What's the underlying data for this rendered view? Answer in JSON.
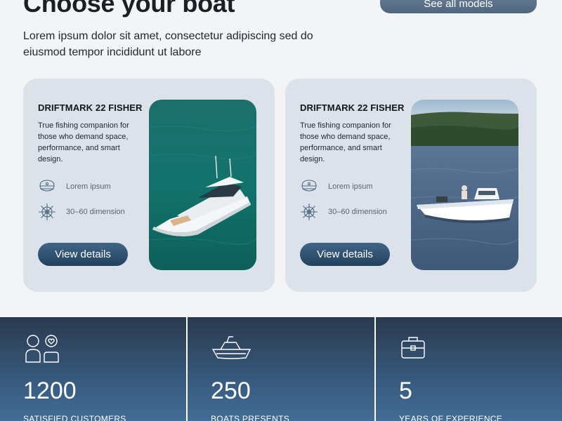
{
  "header": {
    "title": "Choose your boat",
    "see_all_label": "See all models",
    "intro": "Lorem ipsum dolor sit amet, consectetur adipiscing sed do eiusmod tempor incididunt ut labore"
  },
  "cards": [
    {
      "title": "DRIFTMARK 22 FISHER",
      "description": "True fishing companion for those who demand space, performance, and smart design.",
      "features": [
        {
          "icon": "captain-hat-icon",
          "label": "Lorem ipsum"
        },
        {
          "icon": "ship-wheel-icon",
          "label": "30–60 dimension"
        }
      ],
      "button_label": "View details",
      "image": "motor-yacht-on-sea"
    },
    {
      "title": "DRIFTMARK 22 FISHER",
      "description": "True fishing companion for those who demand space, performance, and smart design.",
      "features": [
        {
          "icon": "captain-hat-icon",
          "label": "Lorem ipsum"
        },
        {
          "icon": "ship-wheel-icon",
          "label": "30–60 dimension"
        }
      ],
      "button_label": "View details",
      "image": "fishing-boat-on-lake"
    }
  ],
  "stats": [
    {
      "icon": "customer-heart-icon",
      "value": "1200",
      "label": "SATISFIED CUSTOMERS"
    },
    {
      "icon": "boat-icon",
      "value": "250",
      "label": "BOATS PRESENTS"
    },
    {
      "icon": "briefcase-icon",
      "value": "5",
      "label": "YEARS OF EXPERIENCE"
    }
  ],
  "colors": {
    "card_background": "#dbe2ea",
    "button_primary": "#2f5170",
    "stats_background": "#36577a"
  }
}
